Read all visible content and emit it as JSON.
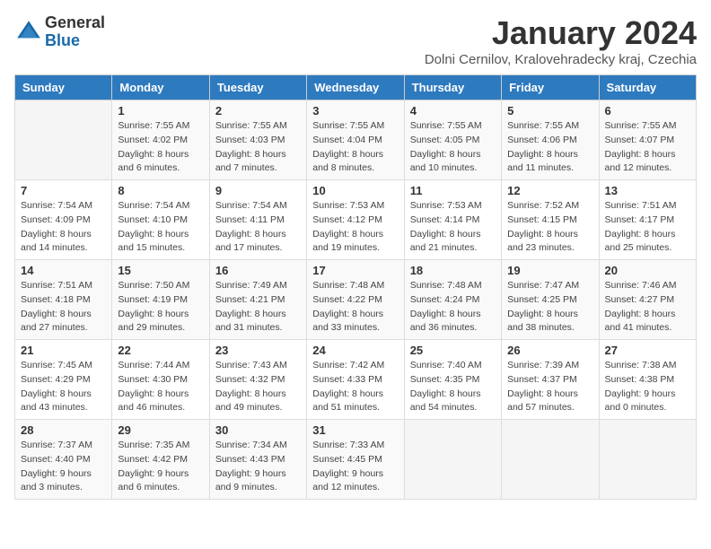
{
  "logo": {
    "general": "General",
    "blue": "Blue"
  },
  "title": "January 2024",
  "location": "Dolni Cernilov, Kralovehradecky kraj, Czechia",
  "days_header": [
    "Sunday",
    "Monday",
    "Tuesday",
    "Wednesday",
    "Thursday",
    "Friday",
    "Saturday"
  ],
  "weeks": [
    [
      {
        "day": "",
        "sunrise": "",
        "sunset": "",
        "daylight": ""
      },
      {
        "day": "1",
        "sunrise": "Sunrise: 7:55 AM",
        "sunset": "Sunset: 4:02 PM",
        "daylight": "Daylight: 8 hours and 6 minutes."
      },
      {
        "day": "2",
        "sunrise": "Sunrise: 7:55 AM",
        "sunset": "Sunset: 4:03 PM",
        "daylight": "Daylight: 8 hours and 7 minutes."
      },
      {
        "day": "3",
        "sunrise": "Sunrise: 7:55 AM",
        "sunset": "Sunset: 4:04 PM",
        "daylight": "Daylight: 8 hours and 8 minutes."
      },
      {
        "day": "4",
        "sunrise": "Sunrise: 7:55 AM",
        "sunset": "Sunset: 4:05 PM",
        "daylight": "Daylight: 8 hours and 10 minutes."
      },
      {
        "day": "5",
        "sunrise": "Sunrise: 7:55 AM",
        "sunset": "Sunset: 4:06 PM",
        "daylight": "Daylight: 8 hours and 11 minutes."
      },
      {
        "day": "6",
        "sunrise": "Sunrise: 7:55 AM",
        "sunset": "Sunset: 4:07 PM",
        "daylight": "Daylight: 8 hours and 12 minutes."
      }
    ],
    [
      {
        "day": "7",
        "sunrise": "Sunrise: 7:54 AM",
        "sunset": "Sunset: 4:09 PM",
        "daylight": "Daylight: 8 hours and 14 minutes."
      },
      {
        "day": "8",
        "sunrise": "Sunrise: 7:54 AM",
        "sunset": "Sunset: 4:10 PM",
        "daylight": "Daylight: 8 hours and 15 minutes."
      },
      {
        "day": "9",
        "sunrise": "Sunrise: 7:54 AM",
        "sunset": "Sunset: 4:11 PM",
        "daylight": "Daylight: 8 hours and 17 minutes."
      },
      {
        "day": "10",
        "sunrise": "Sunrise: 7:53 AM",
        "sunset": "Sunset: 4:12 PM",
        "daylight": "Daylight: 8 hours and 19 minutes."
      },
      {
        "day": "11",
        "sunrise": "Sunrise: 7:53 AM",
        "sunset": "Sunset: 4:14 PM",
        "daylight": "Daylight: 8 hours and 21 minutes."
      },
      {
        "day": "12",
        "sunrise": "Sunrise: 7:52 AM",
        "sunset": "Sunset: 4:15 PM",
        "daylight": "Daylight: 8 hours and 23 minutes."
      },
      {
        "day": "13",
        "sunrise": "Sunrise: 7:51 AM",
        "sunset": "Sunset: 4:17 PM",
        "daylight": "Daylight: 8 hours and 25 minutes."
      }
    ],
    [
      {
        "day": "14",
        "sunrise": "Sunrise: 7:51 AM",
        "sunset": "Sunset: 4:18 PM",
        "daylight": "Daylight: 8 hours and 27 minutes."
      },
      {
        "day": "15",
        "sunrise": "Sunrise: 7:50 AM",
        "sunset": "Sunset: 4:19 PM",
        "daylight": "Daylight: 8 hours and 29 minutes."
      },
      {
        "day": "16",
        "sunrise": "Sunrise: 7:49 AM",
        "sunset": "Sunset: 4:21 PM",
        "daylight": "Daylight: 8 hours and 31 minutes."
      },
      {
        "day": "17",
        "sunrise": "Sunrise: 7:48 AM",
        "sunset": "Sunset: 4:22 PM",
        "daylight": "Daylight: 8 hours and 33 minutes."
      },
      {
        "day": "18",
        "sunrise": "Sunrise: 7:48 AM",
        "sunset": "Sunset: 4:24 PM",
        "daylight": "Daylight: 8 hours and 36 minutes."
      },
      {
        "day": "19",
        "sunrise": "Sunrise: 7:47 AM",
        "sunset": "Sunset: 4:25 PM",
        "daylight": "Daylight: 8 hours and 38 minutes."
      },
      {
        "day": "20",
        "sunrise": "Sunrise: 7:46 AM",
        "sunset": "Sunset: 4:27 PM",
        "daylight": "Daylight: 8 hours and 41 minutes."
      }
    ],
    [
      {
        "day": "21",
        "sunrise": "Sunrise: 7:45 AM",
        "sunset": "Sunset: 4:29 PM",
        "daylight": "Daylight: 8 hours and 43 minutes."
      },
      {
        "day": "22",
        "sunrise": "Sunrise: 7:44 AM",
        "sunset": "Sunset: 4:30 PM",
        "daylight": "Daylight: 8 hours and 46 minutes."
      },
      {
        "day": "23",
        "sunrise": "Sunrise: 7:43 AM",
        "sunset": "Sunset: 4:32 PM",
        "daylight": "Daylight: 8 hours and 49 minutes."
      },
      {
        "day": "24",
        "sunrise": "Sunrise: 7:42 AM",
        "sunset": "Sunset: 4:33 PM",
        "daylight": "Daylight: 8 hours and 51 minutes."
      },
      {
        "day": "25",
        "sunrise": "Sunrise: 7:40 AM",
        "sunset": "Sunset: 4:35 PM",
        "daylight": "Daylight: 8 hours and 54 minutes."
      },
      {
        "day": "26",
        "sunrise": "Sunrise: 7:39 AM",
        "sunset": "Sunset: 4:37 PM",
        "daylight": "Daylight: 8 hours and 57 minutes."
      },
      {
        "day": "27",
        "sunrise": "Sunrise: 7:38 AM",
        "sunset": "Sunset: 4:38 PM",
        "daylight": "Daylight: 9 hours and 0 minutes."
      }
    ],
    [
      {
        "day": "28",
        "sunrise": "Sunrise: 7:37 AM",
        "sunset": "Sunset: 4:40 PM",
        "daylight": "Daylight: 9 hours and 3 minutes."
      },
      {
        "day": "29",
        "sunrise": "Sunrise: 7:35 AM",
        "sunset": "Sunset: 4:42 PM",
        "daylight": "Daylight: 9 hours and 6 minutes."
      },
      {
        "day": "30",
        "sunrise": "Sunrise: 7:34 AM",
        "sunset": "Sunset: 4:43 PM",
        "daylight": "Daylight: 9 hours and 9 minutes."
      },
      {
        "day": "31",
        "sunrise": "Sunrise: 7:33 AM",
        "sunset": "Sunset: 4:45 PM",
        "daylight": "Daylight: 9 hours and 12 minutes."
      },
      {
        "day": "",
        "sunrise": "",
        "sunset": "",
        "daylight": ""
      },
      {
        "day": "",
        "sunrise": "",
        "sunset": "",
        "daylight": ""
      },
      {
        "day": "",
        "sunrise": "",
        "sunset": "",
        "daylight": ""
      }
    ]
  ]
}
